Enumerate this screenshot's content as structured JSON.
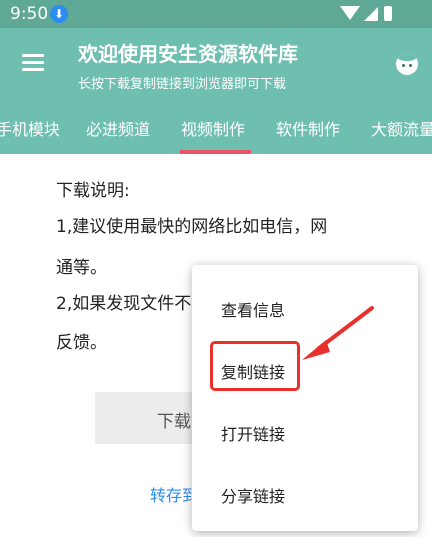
{
  "status_bar": {
    "time": "9:50",
    "download_badge": "⬇"
  },
  "header": {
    "title": "欢迎使用安生资源软件库",
    "subtitle": "长按下载复制链接到浏览器即可下载",
    "tabs": [
      "手机模块",
      "必进频道",
      "视频制作",
      "软件制作",
      "大额流量"
    ],
    "active_tab": "视频制作"
  },
  "content": {
    "lines": [
      "下载说明:",
      "1,建议使用最快的网络比如电信，网",
      "通等。",
      "2,如果发现文件不",
      "反馈。"
    ],
    "download_label": "下载",
    "transfer_label": "转存到"
  },
  "context_menu": {
    "items": [
      "查看信息",
      "复制链接",
      "打开链接",
      "分享链接"
    ],
    "highlighted": "复制链接"
  },
  "colors": {
    "status_bar": "#5fa896",
    "header": "#6fbfb0",
    "indicator": "#e8546a",
    "annotation": "#e8312a",
    "link": "#2d8cf0"
  },
  "icons": [
    "menu-icon",
    "face-icon",
    "wifi-icon",
    "signal-icon",
    "battery-icon",
    "download-icon"
  ]
}
